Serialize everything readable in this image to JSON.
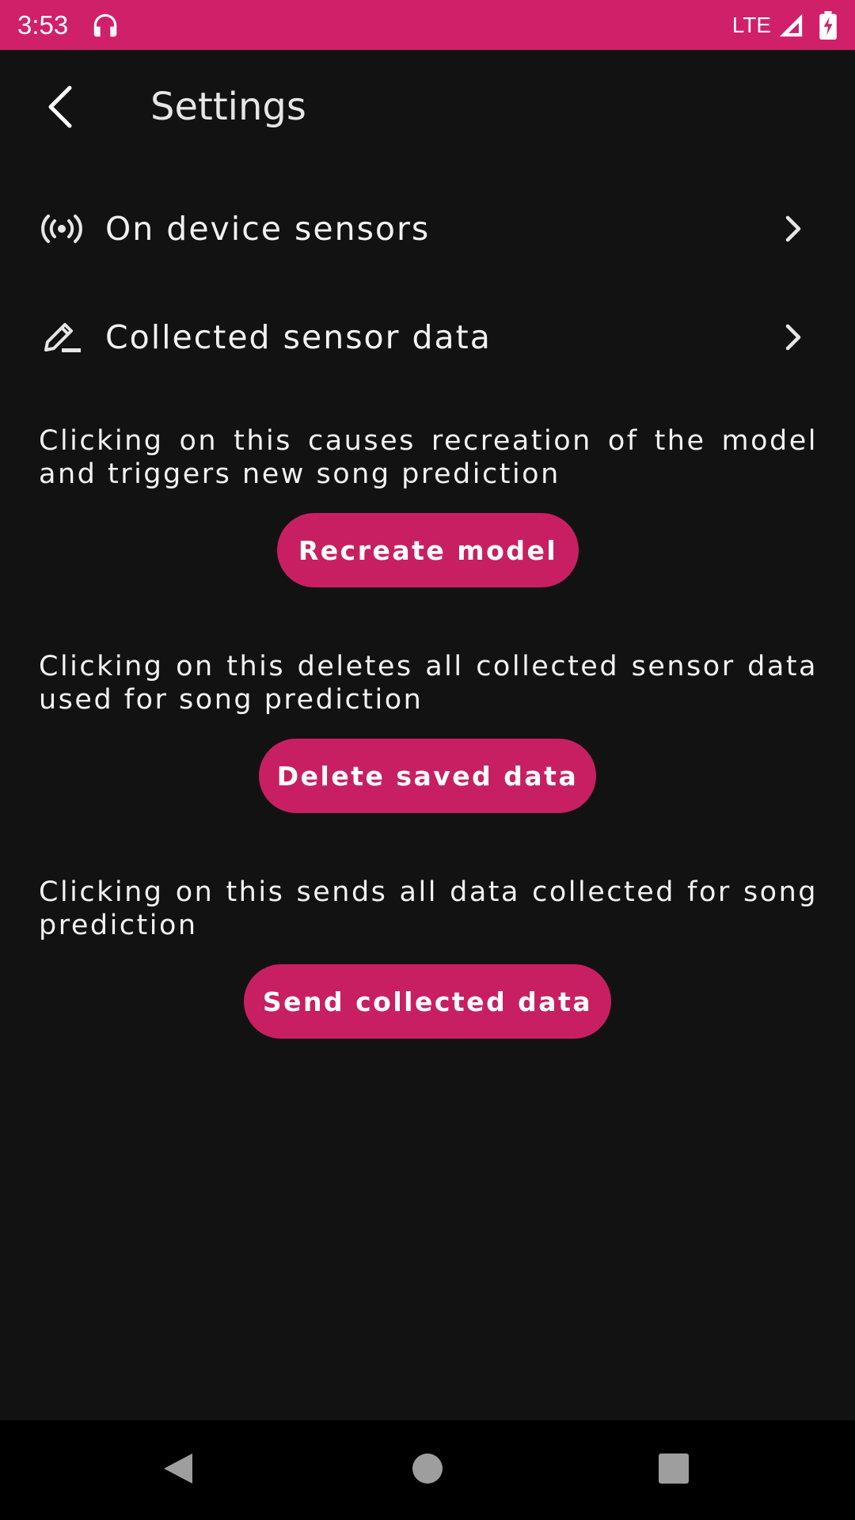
{
  "status_bar": {
    "time": "3:53",
    "network": "LTE",
    "icons": [
      "headphones-icon",
      "signal-icon",
      "battery-charging-icon"
    ],
    "color": "#d0206a"
  },
  "app_bar": {
    "title": "Settings",
    "back_icon": "back-arrow-icon"
  },
  "menu": {
    "items": [
      {
        "label": "On device sensors",
        "icon": "sensors-icon"
      },
      {
        "label": "Collected sensor data",
        "icon": "edit-pencil-icon"
      }
    ]
  },
  "actions": [
    {
      "description": "Clicking on this causes recreation of the model and triggers new song prediction",
      "button_label": "Recreate model"
    },
    {
      "description": "Clicking on this deletes all collected sensor data used for song prediction",
      "button_label": "Delete saved data"
    },
    {
      "description": "Clicking on this sends all data collected for song prediction",
      "button_label": "Send collected data"
    }
  ],
  "nav_bar": {
    "buttons": [
      "back-triangle-icon",
      "home-circle-icon",
      "recents-square-icon"
    ]
  },
  "colors": {
    "accent": "#c81f63",
    "background": "#121212"
  }
}
